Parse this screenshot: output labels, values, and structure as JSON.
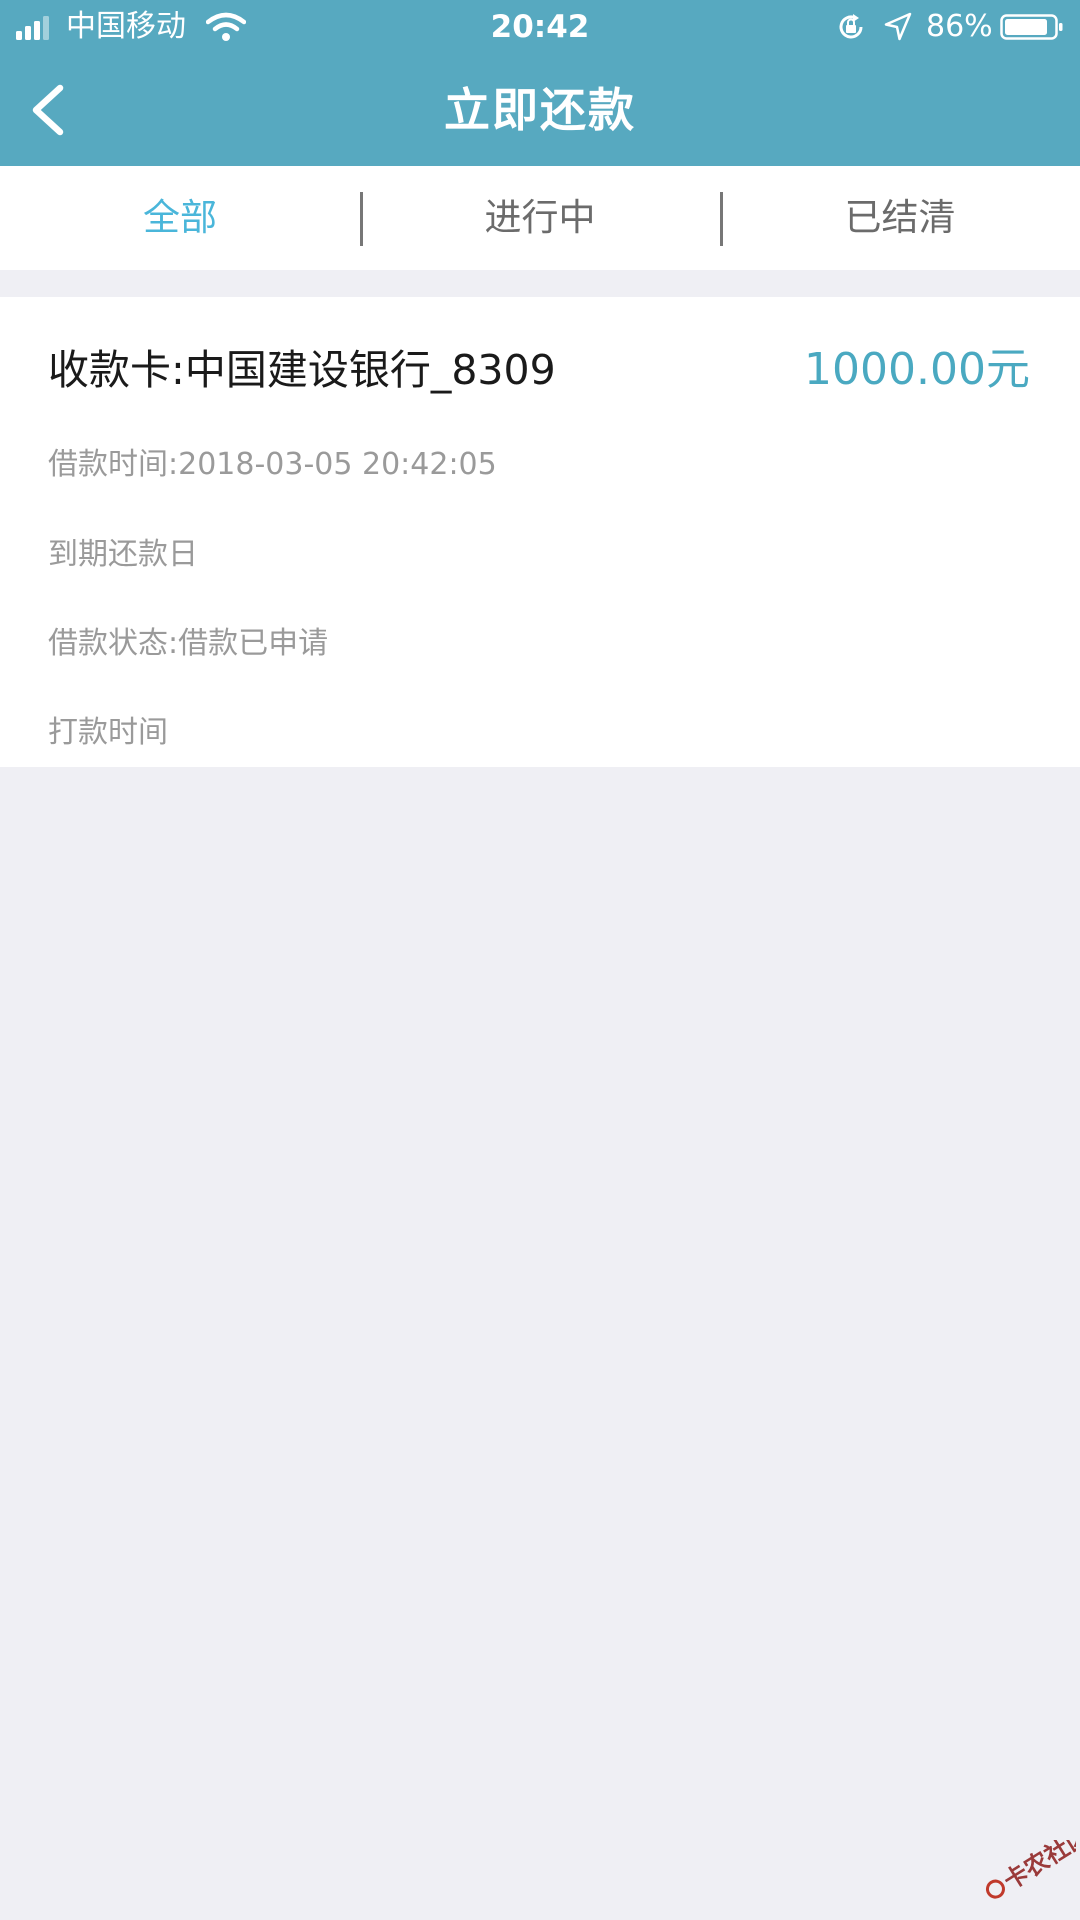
{
  "status_bar": {
    "carrier": "中国移动",
    "time": "20:42",
    "battery": "86%"
  },
  "nav": {
    "title": "立即还款"
  },
  "tabs": [
    {
      "label": "全部",
      "active": true
    },
    {
      "label": "进行中",
      "active": false
    },
    {
      "label": "已结清",
      "active": false
    }
  ],
  "loan": {
    "card_label": "收款卡:中国建设银行_8309",
    "amount": "1000.00元",
    "borrow_time": "借款时间:2018-03-05 20:42:05",
    "due_date": "到期还款日",
    "status": "借款状态:借款已申请",
    "payout_time": "打款时间"
  },
  "watermark": {
    "text": "卡农社区"
  },
  "colors": {
    "header": "#57A9C0",
    "active_tab": "#4AB6DA",
    "amount": "#4AA9C1",
    "background": "#EFEFF4"
  }
}
